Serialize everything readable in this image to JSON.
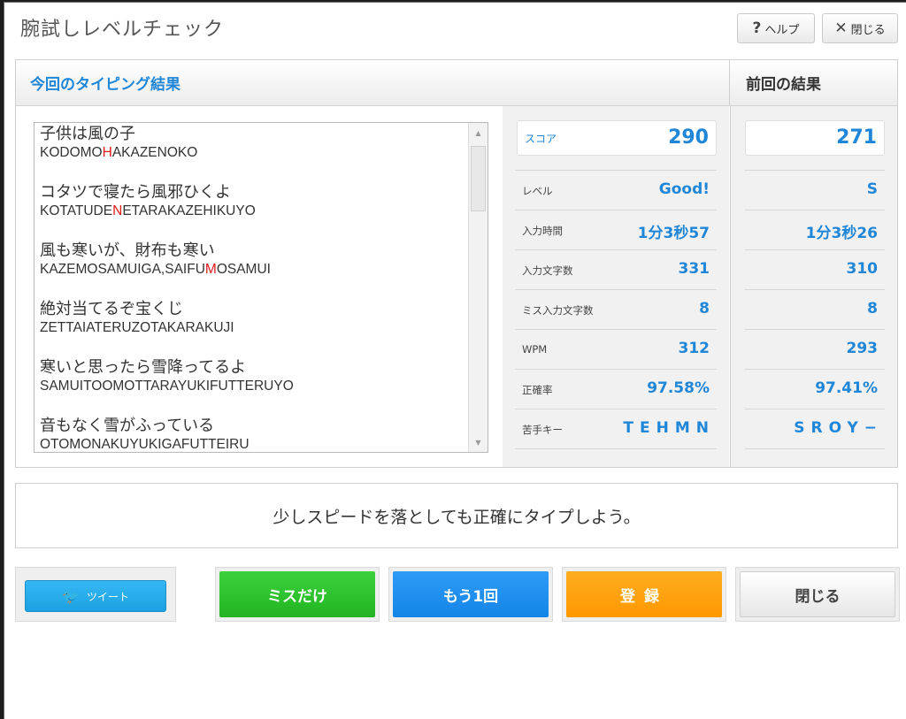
{
  "title": "腕試しレベルチェック",
  "top_buttons": {
    "help_icon": "?",
    "help_label": "ヘルプ",
    "close_icon": "✕",
    "close_label": "閉じる"
  },
  "current": {
    "header": "今回のタイピング結果",
    "words": [
      {
        "jp": "子供は風の子",
        "romaji": [
          "KODOMO",
          "H",
          "AKAZENOKO"
        ]
      },
      {
        "jp": "コタツで寝たら風邪ひくよ",
        "romaji": [
          "KOTATUDE",
          "N",
          "ETARAKAZEHIKUYO"
        ]
      },
      {
        "jp": "風も寒いが、財布も寒い",
        "romaji": [
          "KAZEMOSAMUIGA,SAIFU",
          "M",
          "OSAMUI"
        ]
      },
      {
        "jp": "絶対当てるぞ宝くじ",
        "romaji": [
          "ZETTAIATERUZOTAKARAKUJI",
          "",
          ""
        ]
      },
      {
        "jp": "寒いと思ったら雪降ってるよ",
        "romaji": [
          "SAMUITOOMOTTARAYUKIFUTTERUYO",
          "",
          ""
        ]
      },
      {
        "jp": "音もなく雪がふっている",
        "romaji": [
          "OTOMONAKUYUKIGAFUTTEIRU",
          "",
          ""
        ]
      }
    ],
    "score_label": "スコア",
    "score": "290",
    "stats": [
      {
        "label": "レベル",
        "value": "Good!"
      },
      {
        "label": "入力時間",
        "value": "1分3秒57"
      },
      {
        "label": "入力文字数",
        "value": "331"
      },
      {
        "label": "ミス入力文字数",
        "value": "8"
      },
      {
        "label": "WPM",
        "value": "312"
      },
      {
        "label": "正確率",
        "value": "97.58%"
      },
      {
        "label": "苦手キー",
        "value": "TEHMN"
      }
    ]
  },
  "previous": {
    "header": "前回の結果",
    "score": "271",
    "stats": [
      "S",
      "1分3秒26",
      "310",
      "8",
      "293",
      "97.41%",
      "SROY−"
    ]
  },
  "message": "少しスピードを落としても正確にタイプしよう。",
  "buttons": {
    "tweet": "ツイート",
    "miss_only": "ミスだけ",
    "again": "もう1回",
    "register": "登録",
    "close": "閉じる"
  },
  "colors": {
    "accent_blue": "#1f86d8",
    "miss_red": "#e01818",
    "green": "#22b422",
    "orange": "#ff9800",
    "twitter": "#1da1e3"
  },
  "icons": {
    "help": "question-icon",
    "close": "close-icon",
    "tweet": "twitter-bird-icon",
    "scroll_up": "triangle-up-icon",
    "scroll_down": "triangle-down-icon"
  }
}
